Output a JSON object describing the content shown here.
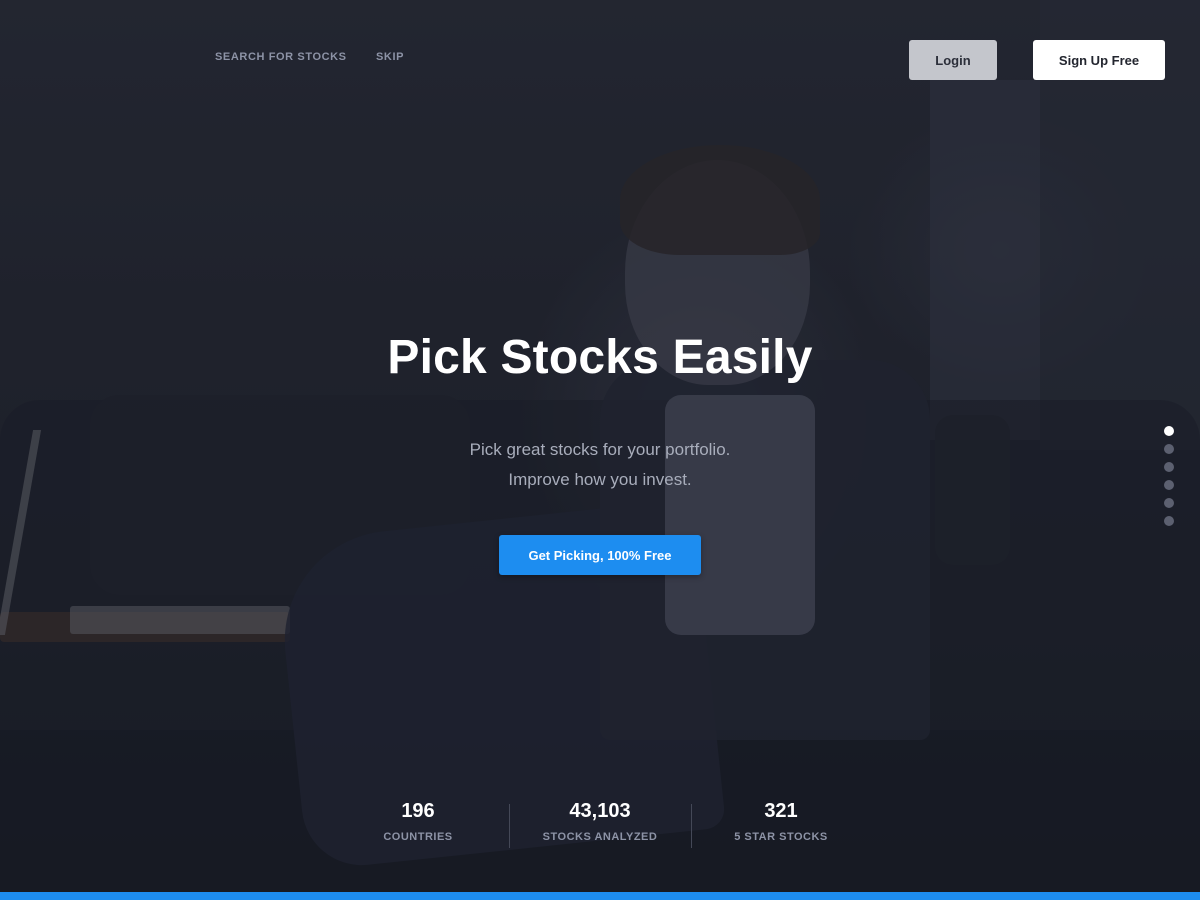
{
  "nav": {
    "search_label": "SEARCH FOR STOCKS",
    "skip_label": "SKIP",
    "login_label": "Login",
    "signup_label": "Sign Up Free"
  },
  "hero": {
    "title": "Pick Stocks Easily",
    "subtitle_line1": "Pick great stocks for your portfolio.",
    "subtitle_line2": "Improve how you invest.",
    "cta_label": "Get Picking, 100% Free"
  },
  "slider": {
    "count": 6,
    "active_index": 0
  },
  "stats": [
    {
      "value": "196",
      "label": "COUNTRIES"
    },
    {
      "value": "43,103",
      "label": "STOCKS ANALYZED"
    },
    {
      "value": "321",
      "label": "5 STAR STOCKS"
    }
  ],
  "colors": {
    "accent": "#1d8df0",
    "background": "#22252f",
    "muted_text": "#8d93a6"
  }
}
